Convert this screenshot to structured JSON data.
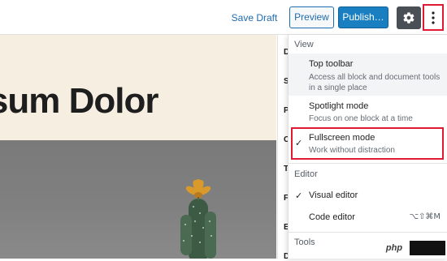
{
  "header": {
    "save_draft_label": "Save Draft",
    "preview_label": "Preview",
    "publish_label": "Publish…",
    "settings_icon": "gear-icon",
    "more_icon": "vertical-ellipsis-icon"
  },
  "canvas": {
    "headline": "psum Dolor"
  },
  "sidebar": {
    "letters": [
      "D",
      "S",
      "P",
      "C",
      "T",
      "F",
      "E",
      "D"
    ]
  },
  "menu": {
    "view_label": "View",
    "top_toolbar": {
      "title": "Top toolbar",
      "description": "Access all block and document tools in a single place"
    },
    "spotlight_mode": {
      "title": "Spotlight mode",
      "description": "Focus on one block at a time"
    },
    "fullscreen_mode": {
      "title": "Fullscreen mode",
      "description": "Work without distraction",
      "check": "✓"
    },
    "editor_label": "Editor",
    "visual_editor": {
      "title": "Visual editor",
      "check": "✓"
    },
    "code_editor": {
      "title": "Code editor",
      "shortcut": "⌥⇧⌘M"
    },
    "tools_label": "Tools"
  },
  "watermark": {
    "text": "php"
  },
  "colors": {
    "accent": "#1a7fc1",
    "highlight": "#e01a33",
    "cover_bg": "#f6efe1"
  }
}
